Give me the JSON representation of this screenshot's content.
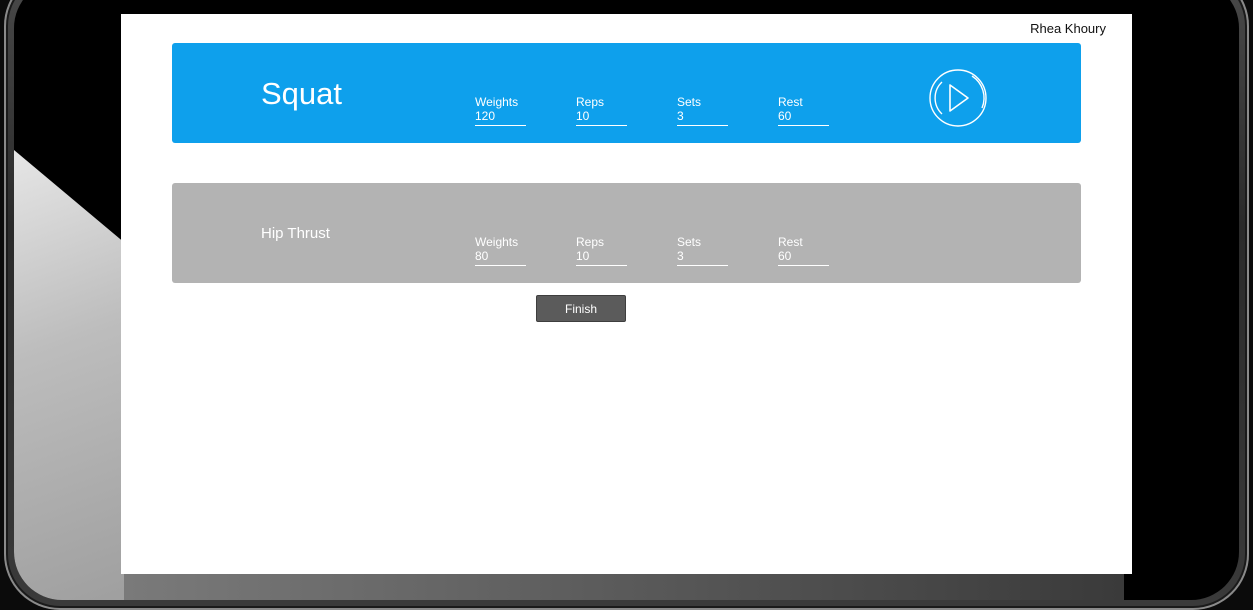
{
  "user": {
    "name": "Rhea Khoury"
  },
  "exercises": [
    {
      "name": "Squat",
      "weights_label": "Weights",
      "weights": "120",
      "reps_label": "Reps",
      "reps": "10",
      "sets_label": "Sets",
      "sets": "3",
      "rest_label": "Rest",
      "rest": "60",
      "color": "#0ea0ec"
    },
    {
      "name": "Hip Thrust",
      "weights_label": "Weights",
      "weights": "80",
      "reps_label": "Reps",
      "reps": "10",
      "sets_label": "Sets",
      "sets": "3",
      "rest_label": "Rest",
      "rest": "60",
      "color": "#b3b3b3"
    }
  ],
  "play_button": {
    "icon": "play-icon"
  },
  "finish_button": {
    "label": "Finish"
  }
}
